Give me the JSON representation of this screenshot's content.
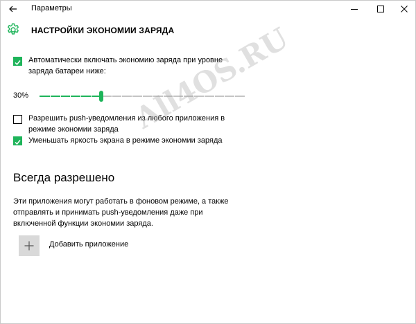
{
  "window": {
    "title": "Параметры",
    "buttons": {
      "back": "back-arrow-icon",
      "minimize": "minimize-icon",
      "maximize": "maximize-icon",
      "close": "close-icon"
    }
  },
  "header": {
    "icon": "gear-icon",
    "title": "НАСТРОЙКИ ЭКОНОМИИ ЗАРЯДА"
  },
  "options": {
    "auto_enable": {
      "checked": true,
      "label_line1": "Автоматически включать экономию заряда при уровне",
      "label_line2": "заряда батареи ниже:"
    },
    "slider": {
      "value_text": "30%",
      "value": 0.3
    },
    "allow_push": {
      "checked": false,
      "label_line1": "Разрешить push-уведомления из любого приложения в",
      "label_line2": "режиме экономии заряда"
    },
    "reduce_brightness": {
      "checked": true,
      "label": "Уменьшать яркость экрана в режиме экономии заряда"
    }
  },
  "always_allowed": {
    "title": "Всегда разрешено",
    "description_line1": "Эти приложения могут работать в фоновом режиме, а также",
    "description_line2": "отправлять и принимать push-уведомления даже при",
    "description_line3": "включенной функции экономии заряда.",
    "add_icon": "plus-icon",
    "add_label": "Добавить приложение"
  },
  "watermark": "All4OS.RU",
  "colors": {
    "accent": "#1eb45a",
    "track": "#c4c4c4",
    "tile": "#d9d9d9"
  }
}
